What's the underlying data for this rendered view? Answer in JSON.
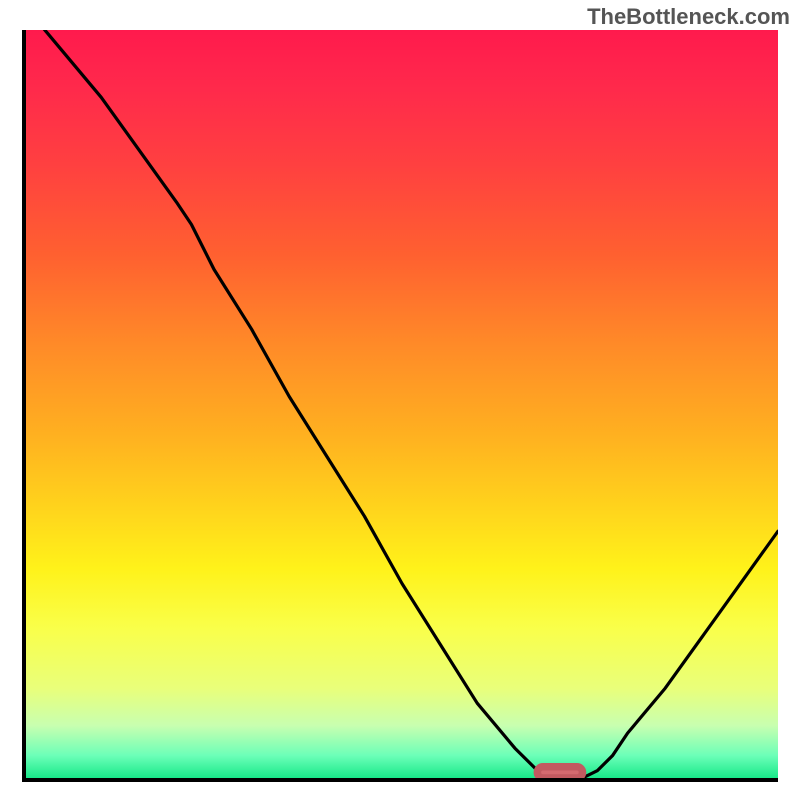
{
  "watermark": "TheBottleneck.com",
  "chart_data": {
    "type": "line",
    "title": "",
    "xlabel": "",
    "ylabel": "",
    "xlim": [
      0,
      100
    ],
    "ylim": [
      0,
      100
    ],
    "x": [
      0,
      5,
      10,
      15,
      20,
      22,
      25,
      30,
      35,
      40,
      45,
      50,
      55,
      60,
      65,
      68,
      70,
      72,
      74,
      76,
      78,
      80,
      85,
      90,
      95,
      100
    ],
    "values": [
      103,
      97,
      91,
      84,
      77,
      74,
      68,
      60,
      51,
      43,
      35,
      26,
      18,
      10,
      4,
      1,
      0,
      0,
      0,
      1,
      3,
      6,
      12,
      19,
      26,
      33
    ],
    "optimal_marker": {
      "x": 71,
      "width": 6,
      "y": 0.6
    },
    "gradient_stops": [
      {
        "pct": 0,
        "color": "#ff1a4d"
      },
      {
        "pct": 18,
        "color": "#ff4040"
      },
      {
        "pct": 42,
        "color": "#ff8a28"
      },
      {
        "pct": 64,
        "color": "#ffd41c"
      },
      {
        "pct": 80,
        "color": "#f9ff4a"
      },
      {
        "pct": 97,
        "color": "#6cffb8"
      },
      {
        "pct": 100,
        "color": "#18e889"
      }
    ]
  }
}
